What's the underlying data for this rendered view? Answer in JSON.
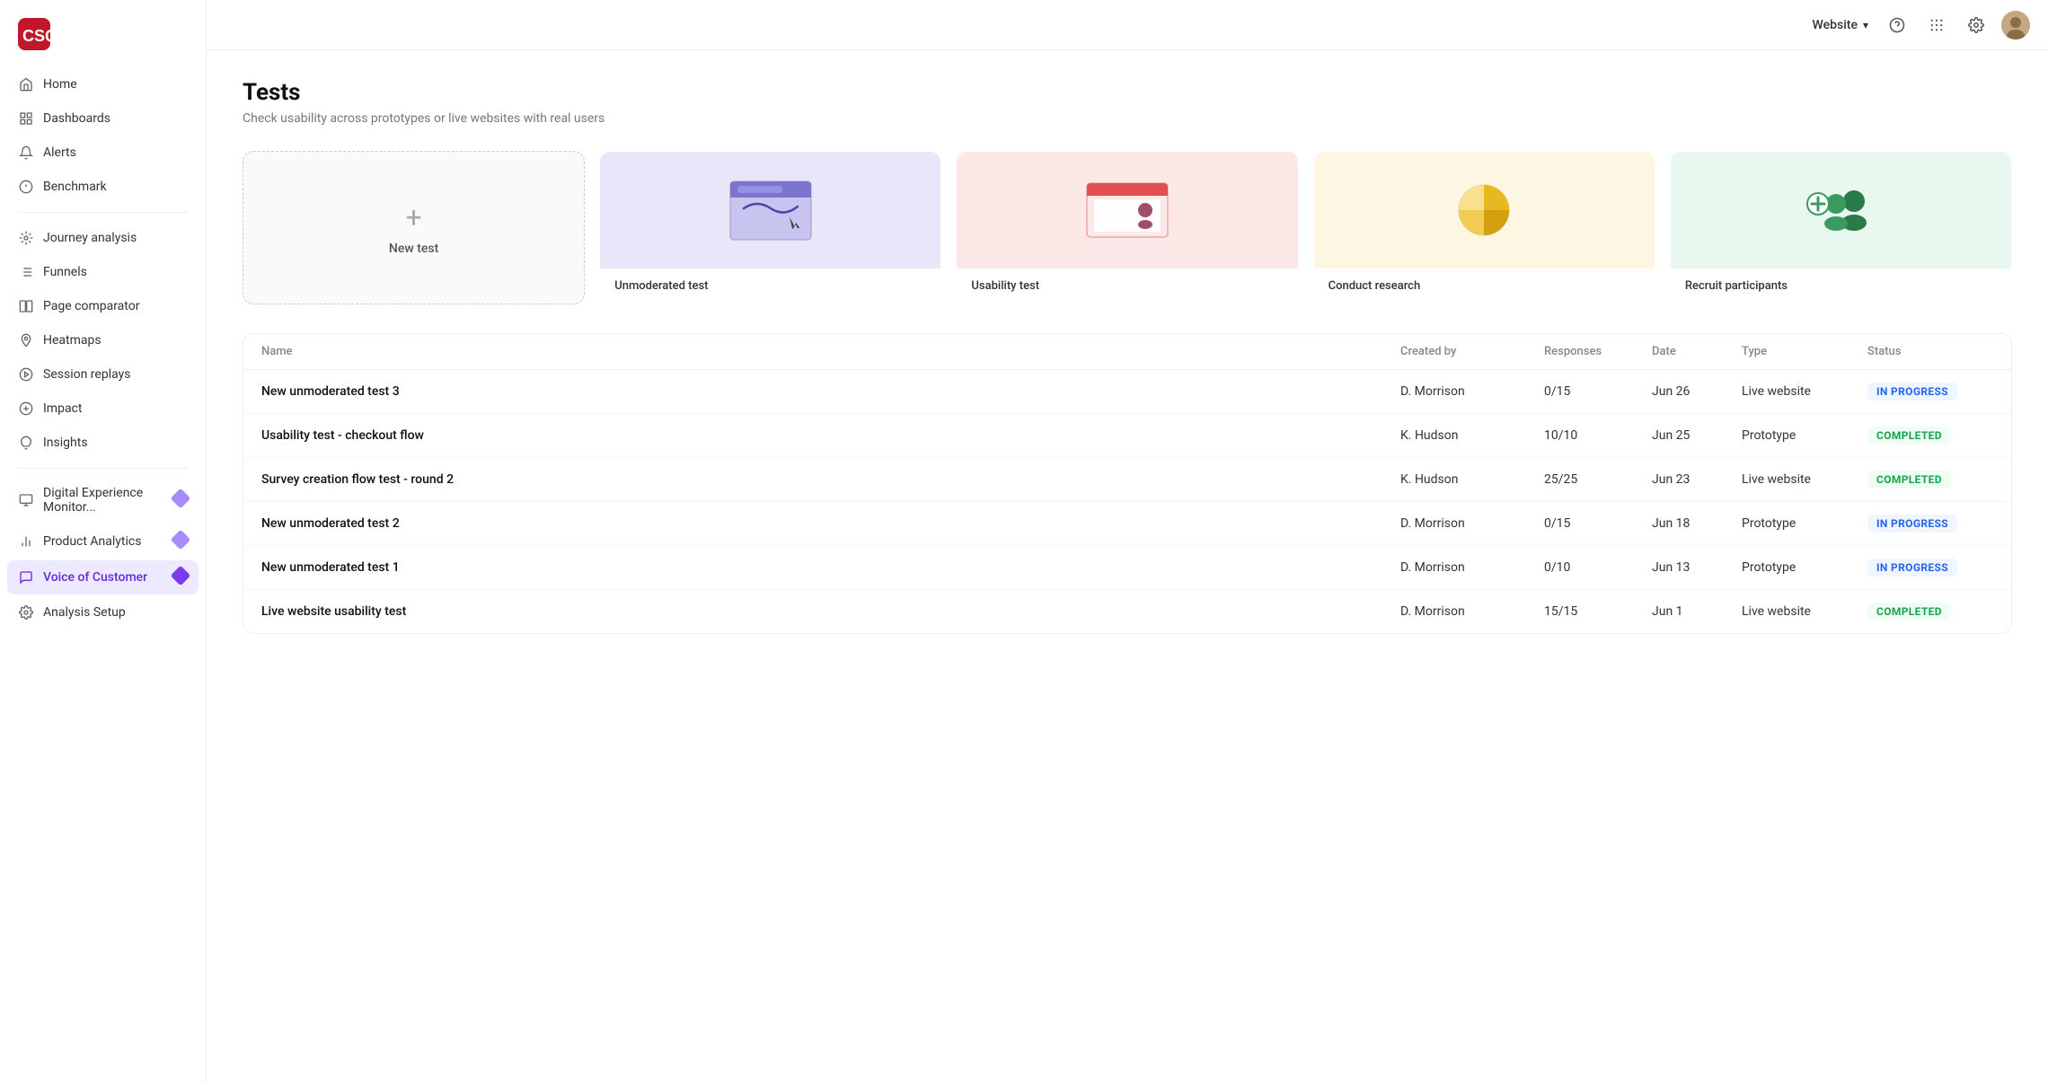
{
  "logo": {
    "text": "CSQ",
    "color": "#c0182a"
  },
  "topbar": {
    "workspace_label": "Website",
    "chevron": "▾"
  },
  "sidebar": {
    "items": [
      {
        "id": "home",
        "label": "Home",
        "icon": "home"
      },
      {
        "id": "dashboards",
        "label": "Dashboards",
        "icon": "dashboard"
      },
      {
        "id": "alerts",
        "label": "Alerts",
        "icon": "bell"
      },
      {
        "id": "benchmark",
        "label": "Benchmark",
        "icon": "benchmark"
      },
      {
        "id": "journey",
        "label": "Journey analysis",
        "icon": "journey"
      },
      {
        "id": "funnels",
        "label": "Funnels",
        "icon": "funnels"
      },
      {
        "id": "page-comparator",
        "label": "Page comparator",
        "icon": "compare"
      },
      {
        "id": "heatmaps",
        "label": "Heatmaps",
        "icon": "heatmap"
      },
      {
        "id": "session-replays",
        "label": "Session replays",
        "icon": "replay"
      },
      {
        "id": "impact",
        "label": "Impact",
        "icon": "impact"
      },
      {
        "id": "insights",
        "label": "Insights",
        "icon": "insights"
      },
      {
        "id": "digital-experience",
        "label": "Digital Experience Monitor...",
        "icon": "monitor",
        "badge": true
      },
      {
        "id": "product-analytics",
        "label": "Product Analytics",
        "icon": "analytics",
        "badge": true
      },
      {
        "id": "voice-of-customer",
        "label": "Voice of Customer",
        "icon": "voc",
        "badge": true,
        "active": true
      },
      {
        "id": "analysis-setup",
        "label": "Analysis Setup",
        "icon": "setup"
      }
    ]
  },
  "page": {
    "title": "Tests",
    "subtitle": "Check usability across prototypes or live websites with real users"
  },
  "cards": [
    {
      "id": "new-test",
      "label": "New test",
      "type": "new"
    },
    {
      "id": "unmoderated-test",
      "label": "Unmoderated test",
      "type": "unmoderated"
    },
    {
      "id": "usability-test",
      "label": "Usability test",
      "type": "usability"
    },
    {
      "id": "conduct-research",
      "label": "Conduct research",
      "type": "research"
    },
    {
      "id": "recruit-participants",
      "label": "Recruit participants",
      "type": "recruit"
    }
  ],
  "table": {
    "headers": [
      "Name",
      "Created by",
      "Responses",
      "Date",
      "Type",
      "Status"
    ],
    "rows": [
      {
        "name": "New unmoderated test 3",
        "created_by": "D. Morrison",
        "responses": "0/15",
        "date": "Jun 26",
        "type": "Live website",
        "status": "IN PROGRESS",
        "status_type": "in-progress"
      },
      {
        "name": "Usability test - checkout flow",
        "created_by": "K. Hudson",
        "responses": "10/10",
        "date": "Jun 25",
        "type": "Prototype",
        "status": "COMPLETED",
        "status_type": "completed"
      },
      {
        "name": "Survey creation flow test - round 2",
        "created_by": "K. Hudson",
        "responses": "25/25",
        "date": "Jun 23",
        "type": "Live website",
        "status": "COMPLETED",
        "status_type": "completed"
      },
      {
        "name": "New unmoderated test 2",
        "created_by": "D. Morrison",
        "responses": "0/15",
        "date": "Jun 18",
        "type": "Prototype",
        "status": "IN PROGRESS",
        "status_type": "in-progress"
      },
      {
        "name": "New unmoderated test 1",
        "created_by": "D. Morrison",
        "responses": "0/10",
        "date": "Jun 13",
        "type": "Prototype",
        "status": "IN PROGRESS",
        "status_type": "in-progress"
      },
      {
        "name": "Live website usability test",
        "created_by": "D. Morrison",
        "responses": "15/15",
        "date": "Jun 1",
        "type": "Live website",
        "status": "COMPLETED",
        "status_type": "completed"
      }
    ]
  }
}
